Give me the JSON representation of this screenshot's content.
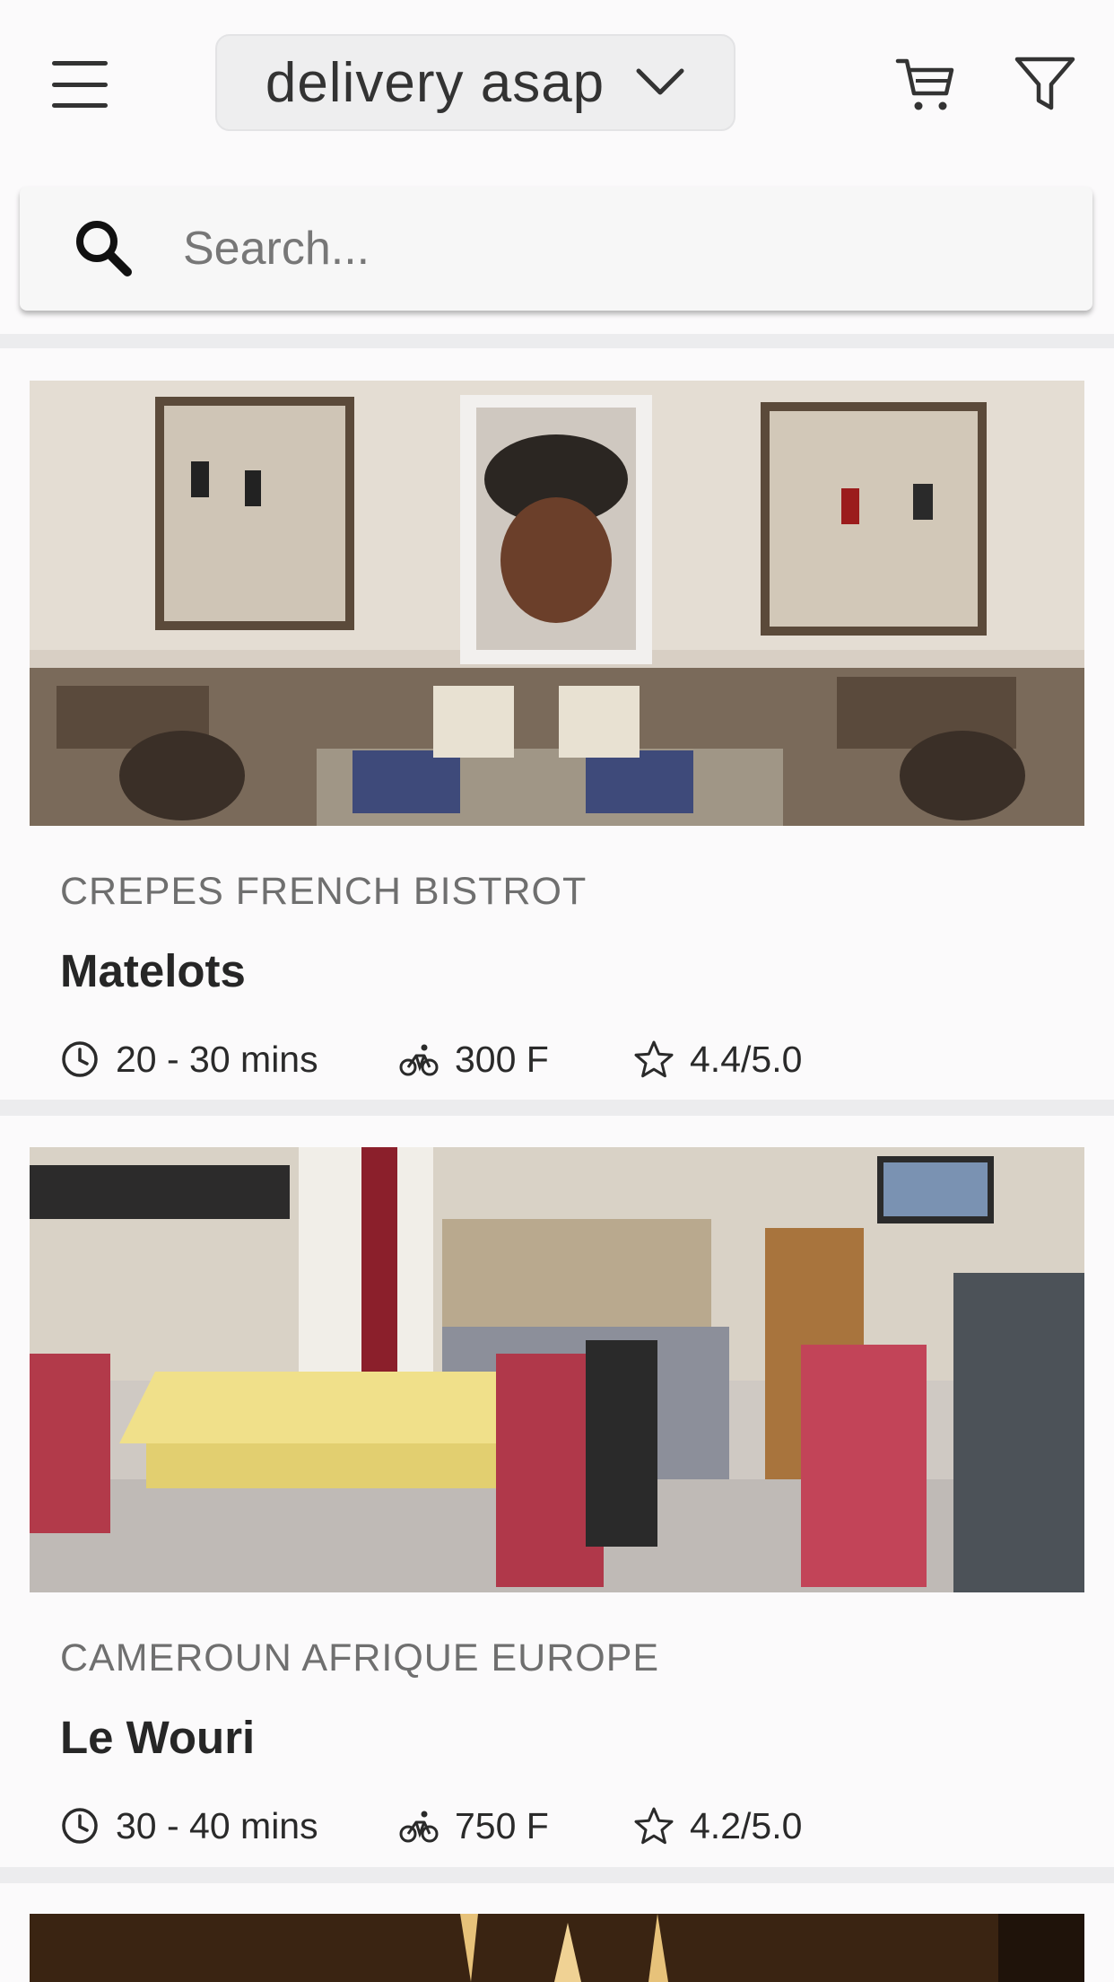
{
  "header": {
    "delivery_mode": "delivery asap",
    "menu_icon": "hamburger-menu-icon",
    "cart_icon": "cart-icon",
    "filter_icon": "filter-icon"
  },
  "search": {
    "placeholder": "Search..."
  },
  "restaurants": [
    {
      "category": "CREPES FRENCH BISTROT",
      "name": "Matelots",
      "time": "20 - 30 mins",
      "delivery_fee": "300 F",
      "rating": "4.4/5.0"
    },
    {
      "category": "CAMEROUN AFRIQUE EUROPE",
      "name": "Le Wouri",
      "time": "30 - 40 mins",
      "delivery_fee": "750 F",
      "rating": "4.2/5.0"
    }
  ],
  "colors": {
    "background": "#fbfafb",
    "band": "#ececee",
    "text_dark": "#262626",
    "text_muted": "#6f6f6f"
  }
}
